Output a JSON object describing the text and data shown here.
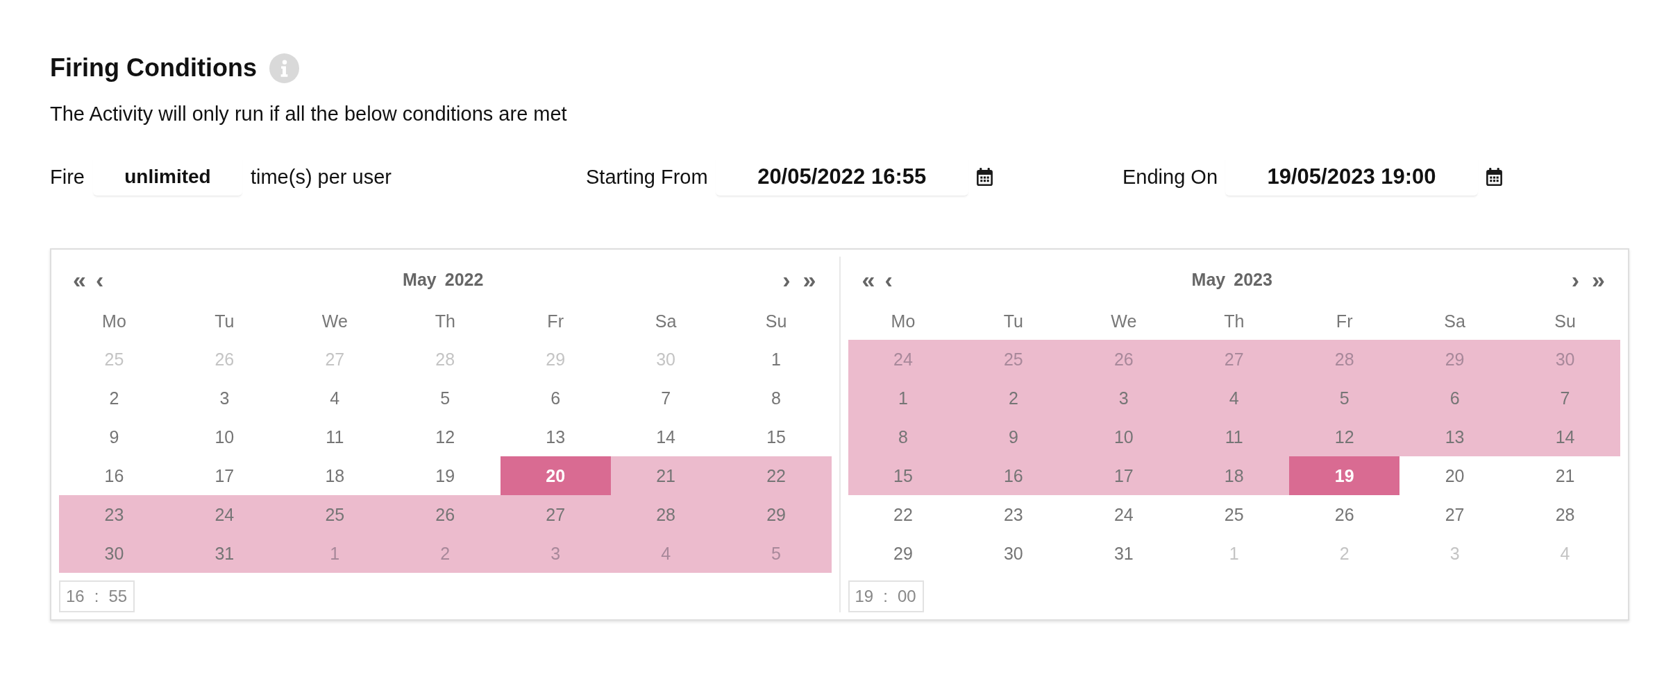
{
  "heading": {
    "title": "Firing Conditions",
    "description": "The Activity will only run if all the below conditions are met"
  },
  "fire_limit": {
    "label": "Fire",
    "value": "unlimited",
    "suffix": "time(s) per user"
  },
  "date_fields": [
    {
      "label": "Starting From",
      "value": "20/05/2022 16:55"
    },
    {
      "label": "Ending On",
      "value": "19/05/2023 19:00"
    }
  ],
  "calendars": [
    {
      "prev_year": "«",
      "prev_month": "‹",
      "month": "May",
      "year": "2022",
      "next_month": "›",
      "next_year": "»",
      "weekdays": [
        "Mo",
        "Tu",
        "We",
        "Th",
        "Fr",
        "Sa",
        "Su"
      ],
      "days": [
        {
          "label": "25",
          "outside_month": true,
          "in_range": false,
          "selected": false
        },
        {
          "label": "26",
          "outside_month": true,
          "in_range": false,
          "selected": false
        },
        {
          "label": "27",
          "outside_month": true,
          "in_range": false,
          "selected": false
        },
        {
          "label": "28",
          "outside_month": true,
          "in_range": false,
          "selected": false
        },
        {
          "label": "29",
          "outside_month": true,
          "in_range": false,
          "selected": false
        },
        {
          "label": "30",
          "outside_month": true,
          "in_range": false,
          "selected": false
        },
        {
          "label": "1",
          "outside_month": false,
          "in_range": false,
          "selected": false
        },
        {
          "label": "2",
          "outside_month": false,
          "in_range": false,
          "selected": false
        },
        {
          "label": "3",
          "outside_month": false,
          "in_range": false,
          "selected": false
        },
        {
          "label": "4",
          "outside_month": false,
          "in_range": false,
          "selected": false
        },
        {
          "label": "5",
          "outside_month": false,
          "in_range": false,
          "selected": false
        },
        {
          "label": "6",
          "outside_month": false,
          "in_range": false,
          "selected": false
        },
        {
          "label": "7",
          "outside_month": false,
          "in_range": false,
          "selected": false
        },
        {
          "label": "8",
          "outside_month": false,
          "in_range": false,
          "selected": false
        },
        {
          "label": "9",
          "outside_month": false,
          "in_range": false,
          "selected": false
        },
        {
          "label": "10",
          "outside_month": false,
          "in_range": false,
          "selected": false
        },
        {
          "label": "11",
          "outside_month": false,
          "in_range": false,
          "selected": false
        },
        {
          "label": "12",
          "outside_month": false,
          "in_range": false,
          "selected": false
        },
        {
          "label": "13",
          "outside_month": false,
          "in_range": false,
          "selected": false
        },
        {
          "label": "14",
          "outside_month": false,
          "in_range": false,
          "selected": false
        },
        {
          "label": "15",
          "outside_month": false,
          "in_range": false,
          "selected": false
        },
        {
          "label": "16",
          "outside_month": false,
          "in_range": false,
          "selected": false
        },
        {
          "label": "17",
          "outside_month": false,
          "in_range": false,
          "selected": false
        },
        {
          "label": "18",
          "outside_month": false,
          "in_range": false,
          "selected": false
        },
        {
          "label": "19",
          "outside_month": false,
          "in_range": false,
          "selected": false
        },
        {
          "label": "20",
          "outside_month": false,
          "in_range": false,
          "selected": true
        },
        {
          "label": "21",
          "outside_month": false,
          "in_range": true,
          "selected": false
        },
        {
          "label": "22",
          "outside_month": false,
          "in_range": true,
          "selected": false
        },
        {
          "label": "23",
          "outside_month": false,
          "in_range": true,
          "selected": false
        },
        {
          "label": "24",
          "outside_month": false,
          "in_range": true,
          "selected": false
        },
        {
          "label": "25",
          "outside_month": false,
          "in_range": true,
          "selected": false
        },
        {
          "label": "26",
          "outside_month": false,
          "in_range": true,
          "selected": false
        },
        {
          "label": "27",
          "outside_month": false,
          "in_range": true,
          "selected": false
        },
        {
          "label": "28",
          "outside_month": false,
          "in_range": true,
          "selected": false
        },
        {
          "label": "29",
          "outside_month": false,
          "in_range": true,
          "selected": false
        },
        {
          "label": "30",
          "outside_month": false,
          "in_range": true,
          "selected": false
        },
        {
          "label": "31",
          "outside_month": false,
          "in_range": true,
          "selected": false
        },
        {
          "label": "1",
          "outside_month": true,
          "in_range": true,
          "selected": false
        },
        {
          "label": "2",
          "outside_month": true,
          "in_range": true,
          "selected": false
        },
        {
          "label": "3",
          "outside_month": true,
          "in_range": true,
          "selected": false
        },
        {
          "label": "4",
          "outside_month": true,
          "in_range": true,
          "selected": false
        },
        {
          "label": "5",
          "outside_month": true,
          "in_range": true,
          "selected": false
        }
      ],
      "time": {
        "hours": "16",
        "separator": ":",
        "minutes": "55"
      }
    },
    {
      "prev_year": "«",
      "prev_month": "‹",
      "month": "May",
      "year": "2023",
      "next_month": "›",
      "next_year": "»",
      "weekdays": [
        "Mo",
        "Tu",
        "We",
        "Th",
        "Fr",
        "Sa",
        "Su"
      ],
      "days": [
        {
          "label": "24",
          "outside_month": true,
          "in_range": true,
          "selected": false
        },
        {
          "label": "25",
          "outside_month": true,
          "in_range": true,
          "selected": false
        },
        {
          "label": "26",
          "outside_month": true,
          "in_range": true,
          "selected": false
        },
        {
          "label": "27",
          "outside_month": true,
          "in_range": true,
          "selected": false
        },
        {
          "label": "28",
          "outside_month": true,
          "in_range": true,
          "selected": false
        },
        {
          "label": "29",
          "outside_month": true,
          "in_range": true,
          "selected": false
        },
        {
          "label": "30",
          "outside_month": true,
          "in_range": true,
          "selected": false
        },
        {
          "label": "1",
          "outside_month": false,
          "in_range": true,
          "selected": false
        },
        {
          "label": "2",
          "outside_month": false,
          "in_range": true,
          "selected": false
        },
        {
          "label": "3",
          "outside_month": false,
          "in_range": true,
          "selected": false
        },
        {
          "label": "4",
          "outside_month": false,
          "in_range": true,
          "selected": false
        },
        {
          "label": "5",
          "outside_month": false,
          "in_range": true,
          "selected": false
        },
        {
          "label": "6",
          "outside_month": false,
          "in_range": true,
          "selected": false
        },
        {
          "label": "7",
          "outside_month": false,
          "in_range": true,
          "selected": false
        },
        {
          "label": "8",
          "outside_month": false,
          "in_range": true,
          "selected": false
        },
        {
          "label": "9",
          "outside_month": false,
          "in_range": true,
          "selected": false
        },
        {
          "label": "10",
          "outside_month": false,
          "in_range": true,
          "selected": false
        },
        {
          "label": "11",
          "outside_month": false,
          "in_range": true,
          "selected": false
        },
        {
          "label": "12",
          "outside_month": false,
          "in_range": true,
          "selected": false
        },
        {
          "label": "13",
          "outside_month": false,
          "in_range": true,
          "selected": false
        },
        {
          "label": "14",
          "outside_month": false,
          "in_range": true,
          "selected": false
        },
        {
          "label": "15",
          "outside_month": false,
          "in_range": true,
          "selected": false
        },
        {
          "label": "16",
          "outside_month": false,
          "in_range": true,
          "selected": false
        },
        {
          "label": "17",
          "outside_month": false,
          "in_range": true,
          "selected": false
        },
        {
          "label": "18",
          "outside_month": false,
          "in_range": true,
          "selected": false
        },
        {
          "label": "19",
          "outside_month": false,
          "in_range": false,
          "selected": true
        },
        {
          "label": "20",
          "outside_month": false,
          "in_range": false,
          "selected": false
        },
        {
          "label": "21",
          "outside_month": false,
          "in_range": false,
          "selected": false
        },
        {
          "label": "22",
          "outside_month": false,
          "in_range": false,
          "selected": false
        },
        {
          "label": "23",
          "outside_month": false,
          "in_range": false,
          "selected": false
        },
        {
          "label": "24",
          "outside_month": false,
          "in_range": false,
          "selected": false
        },
        {
          "label": "25",
          "outside_month": false,
          "in_range": false,
          "selected": false
        },
        {
          "label": "26",
          "outside_month": false,
          "in_range": false,
          "selected": false
        },
        {
          "label": "27",
          "outside_month": false,
          "in_range": false,
          "selected": false
        },
        {
          "label": "28",
          "outside_month": false,
          "in_range": false,
          "selected": false
        },
        {
          "label": "29",
          "outside_month": false,
          "in_range": false,
          "selected": false
        },
        {
          "label": "30",
          "outside_month": false,
          "in_range": false,
          "selected": false
        },
        {
          "label": "31",
          "outside_month": false,
          "in_range": false,
          "selected": false
        },
        {
          "label": "1",
          "outside_month": true,
          "in_range": false,
          "selected": false
        },
        {
          "label": "2",
          "outside_month": true,
          "in_range": false,
          "selected": false
        },
        {
          "label": "3",
          "outside_month": true,
          "in_range": false,
          "selected": false
        },
        {
          "label": "4",
          "outside_month": true,
          "in_range": false,
          "selected": false
        }
      ],
      "time": {
        "hours": "19",
        "separator": ":",
        "minutes": "00"
      }
    }
  ]
}
